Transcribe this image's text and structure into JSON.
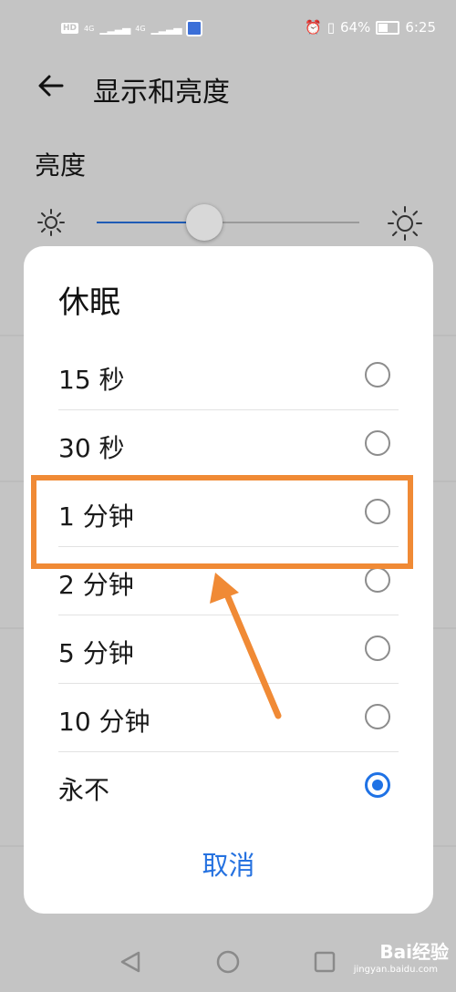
{
  "status_bar": {
    "hd_badge": "HD",
    "signal_1_label": "4G",
    "signal_2_label": "4G",
    "battery_percent": "64%",
    "battery_level": 0.64,
    "time": "6:25"
  },
  "header": {
    "title": "显示和亮度"
  },
  "brightness": {
    "section_title": "亮度",
    "level": 0.41
  },
  "dialog": {
    "title": "休眠",
    "options": [
      {
        "label": "15 秒",
        "selected": false
      },
      {
        "label": "30 秒",
        "selected": false
      },
      {
        "label": "1 分钟",
        "selected": false
      },
      {
        "label": "2 分钟",
        "selected": false
      },
      {
        "label": "5 分钟",
        "selected": false
      },
      {
        "label": "10 分钟",
        "selected": false
      },
      {
        "label": "永不",
        "selected": true
      }
    ],
    "cancel_label": "取消"
  },
  "annotation": {
    "color": "#f08a35"
  },
  "colors": {
    "accent": "#2672e0",
    "slider_fill": "#1f5bb5",
    "background": "#c4c4c4"
  },
  "watermark": {
    "brand": "Bai经验",
    "url": "jingyan.baidu.com"
  }
}
